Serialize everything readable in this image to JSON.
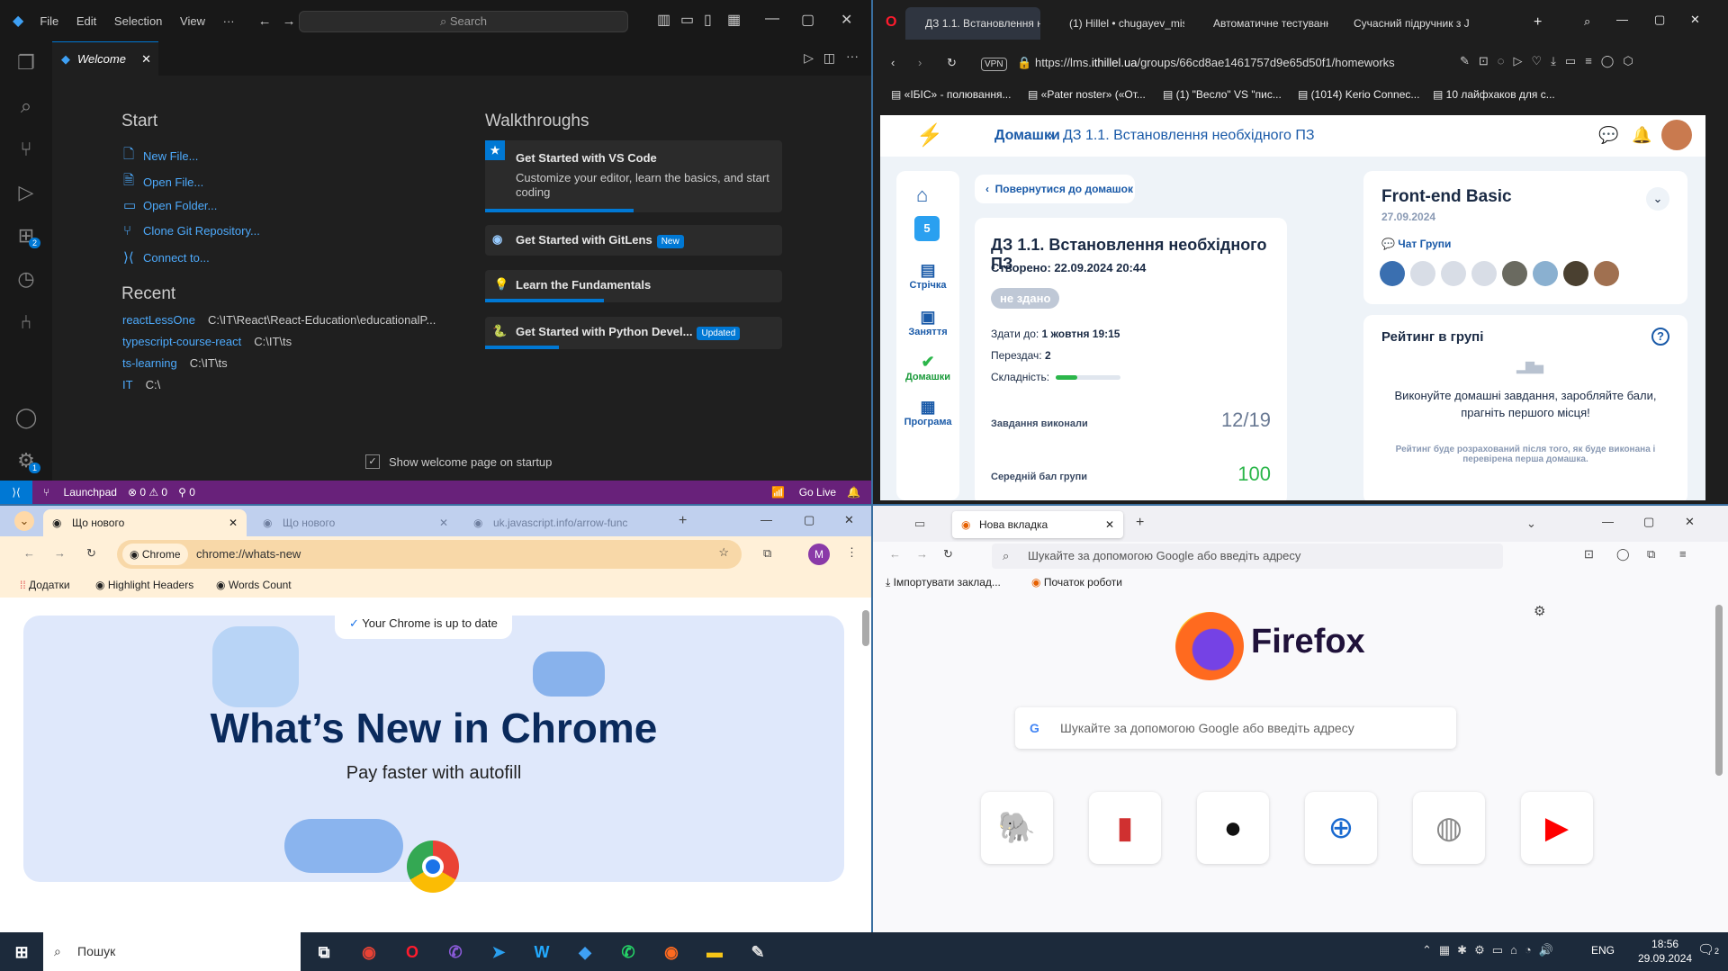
{
  "vscode": {
    "menu": [
      "File",
      "Edit",
      "Selection",
      "View",
      "···"
    ],
    "search_placeholder": "Search",
    "tab": "Welcome",
    "start_title": "Start",
    "start_items": [
      "New File...",
      "Open File...",
      "Open Folder...",
      "Clone Git Repository...",
      "Connect to..."
    ],
    "recent_title": "Recent",
    "recent": [
      {
        "name": "reactLessOne",
        "path": "C:\\IT\\React\\React-Education\\educationalP..."
      },
      {
        "name": "typescript-course-react",
        "path": "C:\\IT\\ts"
      },
      {
        "name": "ts-learning",
        "path": "C:\\IT\\ts"
      },
      {
        "name": "IT",
        "path": "C:\\"
      }
    ],
    "walkthroughs_title": "Walkthroughs",
    "walk1_title": "Get Started with VS Code",
    "walk1_desc": "Customize your editor, learn the basics, and start coding",
    "walk2_title": "Get Started with GitLens",
    "walk2_badge": "New",
    "walk3_title": "Learn the Fundamentals",
    "walk4_title": "Get Started with Python Devel...",
    "walk4_badge": "Updated",
    "show_welcome": "Show welcome page on startup",
    "status": {
      "launchpad": "Launchpad",
      "problems": "⊗ 0 ⚠ 0",
      "ports": "⚲ 0",
      "golive": "Go Live"
    },
    "extensions_badge": "2",
    "settings_badge": "1"
  },
  "opera": {
    "tabs": [
      "ДЗ 1.1. Встановлення нео",
      "(1) Hillel • chugayev_mis",
      "Автоматичне тестуванн",
      "Сучасний підручник з Ja"
    ],
    "url_prefix": "https://lms.",
    "url_domain": "ithillel.ua",
    "url_rest": "/groups/66cd8ae1461757d9e65d50f1/homeworks",
    "bookmarks": [
      "«ІБІС» - полювання...",
      "«Pater noster» («От...",
      "(1) \"Весло\" VS \"пис...",
      "(1014) Kerio Connec...",
      "10 лайфхаков для с..."
    ],
    "vpn": "VPN",
    "breadcrumb_root": "Домашки",
    "breadcrumb_current": "ДЗ 1.1. Встановлення необхідного ПЗ",
    "back_button": "Повернутися до домашок",
    "sidebar": [
      "Стрічка",
      "Заняття",
      "Домашки",
      "Програма"
    ],
    "hw_title": "ДЗ 1.1. Встановлення необхідного ПЗ",
    "created": "Створено: 22.09.2024 20:44",
    "status_badge": "не здано",
    "due_label": "Здати до:",
    "due_value": "1 жовтня 19:15",
    "resub_label": "Перездач:",
    "resub_value": "2",
    "difficulty_label": "Складність:",
    "difficulty_level": 0.33,
    "done_label": "Завдання виконали",
    "done_value": "12/19",
    "avg_label": "Середній бал групи",
    "avg_value": "100",
    "course_title": "Front-end Basic",
    "course_date": "27.09.2024",
    "chat_label": "Чат Групи",
    "rating_title": "Рейтинг в групі",
    "rating_text": "Виконуйте домашні завдання, заробляйте бали, прагніть першого місця!",
    "rating_note": "Рейтинг буде розрахований після того, як буде виконана і перевірена перша домашка."
  },
  "chrome": {
    "tabs": [
      "Що нового",
      "Що нового",
      "uk.javascript.info/arrow-func"
    ],
    "chip": "Chrome",
    "url": "chrome://whats-new",
    "bookmarks": [
      "Додатки",
      "Highlight Headers",
      "Words Count"
    ],
    "profile": "M",
    "uptodate": "Your Chrome is up to date",
    "headline": "What’s New in Chrome",
    "subhead": "Pay faster with autofill"
  },
  "firefox": {
    "tab": "Нова вкладка",
    "url_placeholder": "Шукайте за допомогою Google або введіть адресу",
    "bookmarks": [
      "Імпортувати заклад...",
      "Початок роботи"
    ],
    "brand": "Firefox",
    "search_placeholder": "Шукайте за допомогою Google або введіть адресу"
  },
  "taskbar": {
    "search": "Пошук",
    "lang": "ENG",
    "time": "18:56",
    "date": "29.09.2024",
    "notif": "2"
  }
}
